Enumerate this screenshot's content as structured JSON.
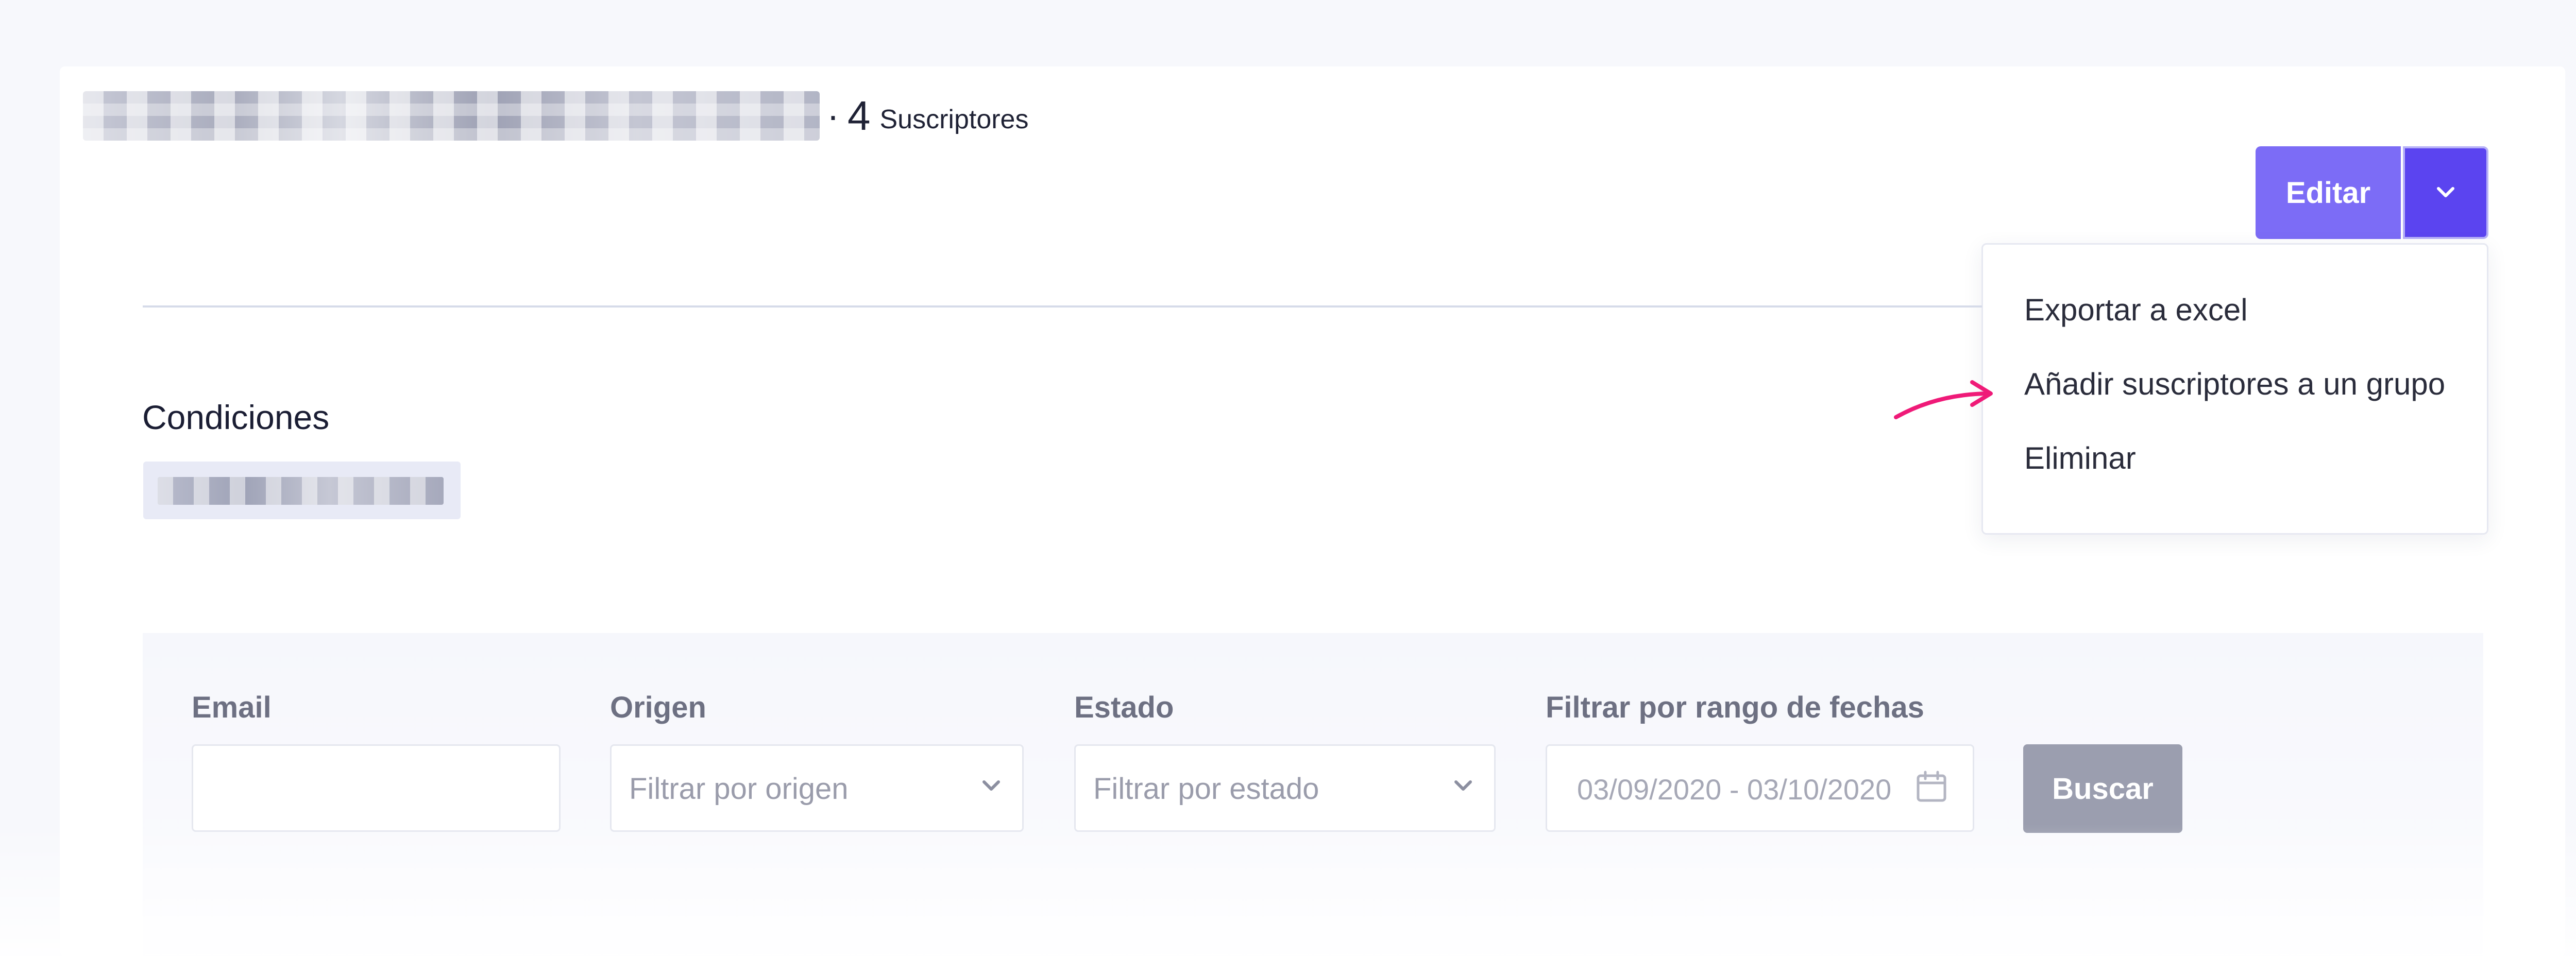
{
  "header": {
    "separator": "·",
    "subscriber_count": "4",
    "subscriber_label": "Suscriptores"
  },
  "actions": {
    "edit_label": "Editar",
    "menu": [
      "Exportar a excel",
      "Añadir suscriptores a un grupo",
      "Eliminar"
    ]
  },
  "conditions": {
    "title": "Condiciones"
  },
  "filters": {
    "email_label": "Email",
    "email_value": "",
    "origin_label": "Origen",
    "origin_placeholder": "Filtrar por origen",
    "status_label": "Estado",
    "status_placeholder": "Filtrar por estado",
    "date_label": "Filtrar por rango de fechas",
    "date_value": "03/09/2020 - 03/10/2020",
    "search_label": "Buscar"
  },
  "icons": {
    "caret": "chevron-down-icon",
    "calendar": "calendar-icon",
    "annotation": "arrow-annotation"
  },
  "colors": {
    "primary": "#7c6cf6",
    "primary_dark": "#5b44f0",
    "annotation": "#ef1a78",
    "disabled_button": "#9b9eaf"
  }
}
